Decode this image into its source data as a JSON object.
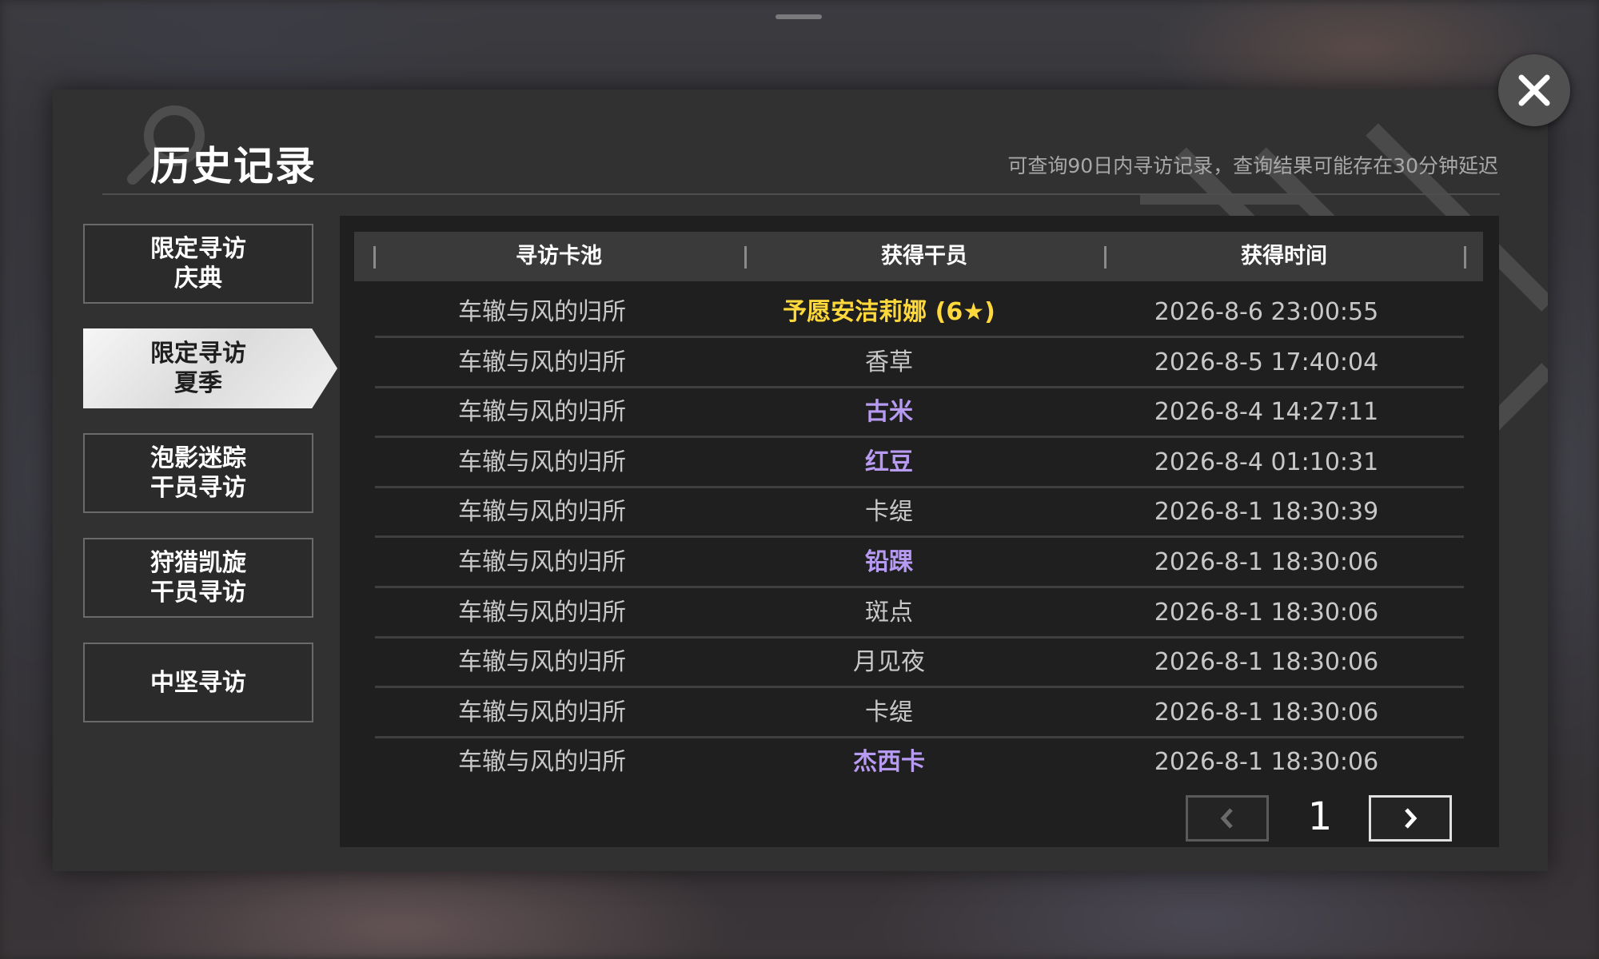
{
  "title": "历史记录",
  "notice": "可查询90日内寻访记录，查询结果可能存在30分钟延迟",
  "colors": {
    "normal": "#c8c8c8",
    "purple": "#b79af2",
    "gold": "#ffd83b"
  },
  "sidebar": {
    "items": [
      {
        "label": "限定寻访\n庆典",
        "active": false
      },
      {
        "label": "限定寻访\n夏季",
        "active": true
      },
      {
        "label": "泡影迷踪\n干员寻访",
        "active": false
      },
      {
        "label": "狩猎凯旋\n干员寻访",
        "active": false
      },
      {
        "label": "中坚寻访",
        "active": false
      }
    ]
  },
  "table": {
    "headers": [
      "寻访卡池",
      "获得干员",
      "获得时间"
    ],
    "rows": [
      {
        "pool": "车辙与风的归所",
        "operator": "予愿安洁莉娜 (6★)",
        "rarity": "gold",
        "time": "2026-8-6 23:00:55"
      },
      {
        "pool": "车辙与风的归所",
        "operator": "香草",
        "rarity": "normal",
        "time": "2026-8-5 17:40:04"
      },
      {
        "pool": "车辙与风的归所",
        "operator": "古米",
        "rarity": "purple",
        "time": "2026-8-4 14:27:11"
      },
      {
        "pool": "车辙与风的归所",
        "operator": "红豆",
        "rarity": "purple",
        "time": "2026-8-4 01:10:31"
      },
      {
        "pool": "车辙与风的归所",
        "operator": "卡缇",
        "rarity": "normal",
        "time": "2026-8-1 18:30:39"
      },
      {
        "pool": "车辙与风的归所",
        "operator": "铅踝",
        "rarity": "purple",
        "time": "2026-8-1 18:30:06"
      },
      {
        "pool": "车辙与风的归所",
        "operator": "斑点",
        "rarity": "normal",
        "time": "2026-8-1 18:30:06"
      },
      {
        "pool": "车辙与风的归所",
        "operator": "月见夜",
        "rarity": "normal",
        "time": "2026-8-1 18:30:06"
      },
      {
        "pool": "车辙与风的归所",
        "operator": "卡缇",
        "rarity": "normal",
        "time": "2026-8-1 18:30:06"
      },
      {
        "pool": "车辙与风的归所",
        "operator": "杰西卡",
        "rarity": "purple",
        "time": "2026-8-1 18:30:06"
      }
    ]
  },
  "pager": {
    "page": "1",
    "prev_icon": "chevron-left-icon",
    "next_icon": "chevron-right-icon"
  },
  "close_icon": "close-icon"
}
